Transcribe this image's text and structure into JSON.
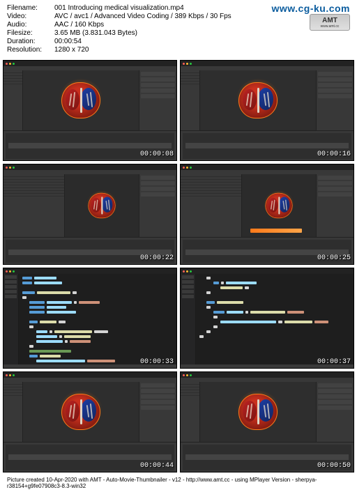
{
  "meta": {
    "filename_label": "Filename:",
    "filename_value": "001 Introducing medical visualization.mp4",
    "video_label": "Video:",
    "video_value": "AVC / avc1 / Advanced Video Coding / 389 Kbps / 30 Fps",
    "audio_label": "Audio:",
    "audio_value": "AAC / 160 Kbps",
    "filesize_label": "Filesize:",
    "filesize_value": "3.65 MB (3.831.043 Bytes)",
    "duration_label": "Duration:",
    "duration_value": "00:00:54",
    "resolution_label": "Resolution:",
    "resolution_value": "1280 x 720"
  },
  "watermark": {
    "url": "www.cg-ku.com",
    "logo_big": "AMT",
    "logo_small": "www.amt.cc"
  },
  "thumbs": {
    "t0": "00:00:08",
    "t1": "00:00:16",
    "t2": "00:00:22",
    "t3": "00:00:25",
    "t4": "00:00:33",
    "t5": "00:00:37",
    "t6": "00:00:44",
    "t7": "00:00:50"
  },
  "footer": "Picture created 10-Apr-2020 with AMT - Auto-Movie-Thumbnailer - v12 - http://www.amt.cc - using MPlayer Version - sherpya-r38154+g9fe07908c3-8.3-win32"
}
